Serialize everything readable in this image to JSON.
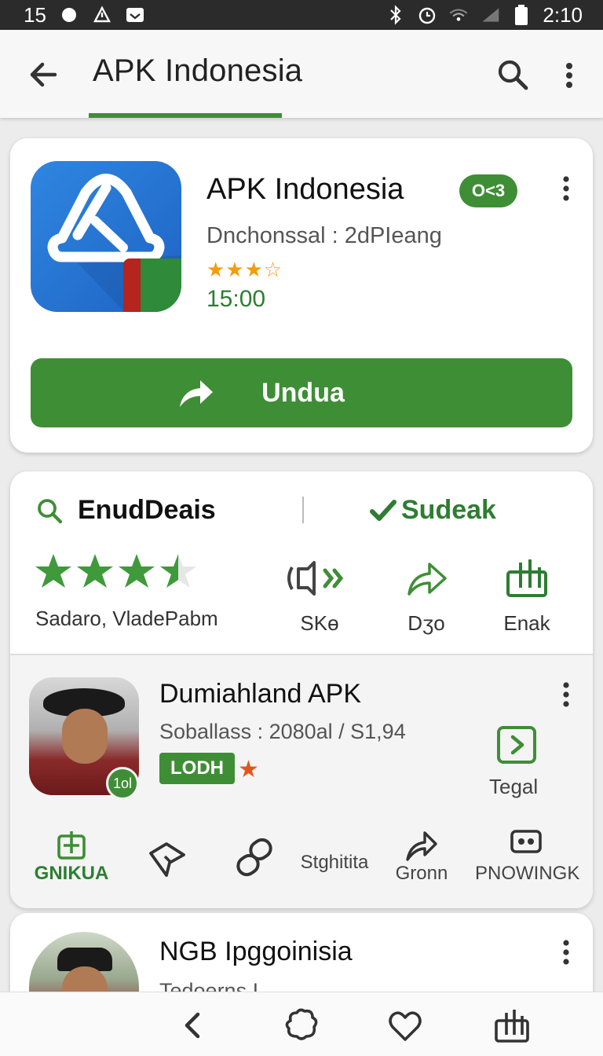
{
  "status_bar": {
    "left_text": "15",
    "time": "2:10"
  },
  "app_bar": {
    "title": "APK Indonesia"
  },
  "app_card": {
    "name": "APK Indonesia",
    "badge": "O<3",
    "subtitle": "Dnchonssal : 2dPIeang",
    "stars": "★★★☆",
    "time": "15:00",
    "download_label": "Undua"
  },
  "details_card": {
    "left_tab": "EnudDeais",
    "right_tab": "Sudeak",
    "rating_label": "Sadaro, VladePabm",
    "actions": [
      {
        "label": "SKɵ"
      },
      {
        "label": "Dʒo"
      },
      {
        "label": "Enak"
      }
    ]
  },
  "list_items": [
    {
      "title": "Dumiahland APK",
      "subtitle": "Soballass : 2080al / S1,94",
      "badge": "LODH",
      "avatar_badge": "1ol",
      "side_label": "Tegal",
      "actions": [
        "GNIKUA",
        "",
        "",
        "Stghitita",
        "Gronn",
        "PNOWINGK"
      ]
    },
    {
      "title": "NGB Ipggoinisia",
      "subtitle": "Tedoerns I..."
    }
  ],
  "colors": {
    "accent": "#3e8e35",
    "accent_text": "#2e7d32",
    "icon_blue": "#1e63c4"
  }
}
